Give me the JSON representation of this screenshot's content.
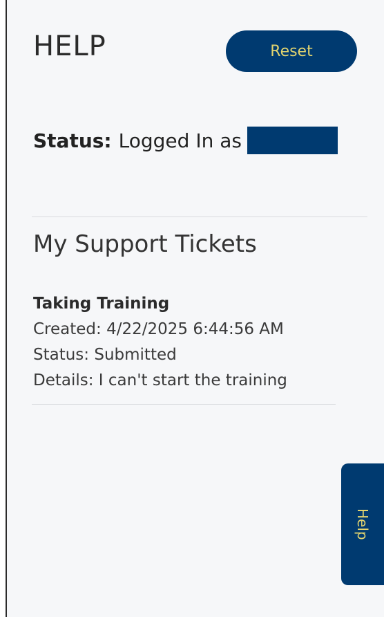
{
  "header": {
    "title": "HELP",
    "reset_label": "Reset"
  },
  "status": {
    "label": "Status:",
    "text": "Logged In as"
  },
  "tickets": {
    "heading": "My Support Tickets",
    "items": [
      {
        "title": "Taking Training",
        "created": "Created: 4/22/2025 6:44:56 AM",
        "status": "Status: Submitted",
        "details": "Details: I can't start the training"
      }
    ]
  },
  "help_tab": {
    "label": "Help"
  },
  "colors": {
    "accent": "#003a70",
    "accent_text": "#e2d46f",
    "background": "#f6f7f9"
  }
}
